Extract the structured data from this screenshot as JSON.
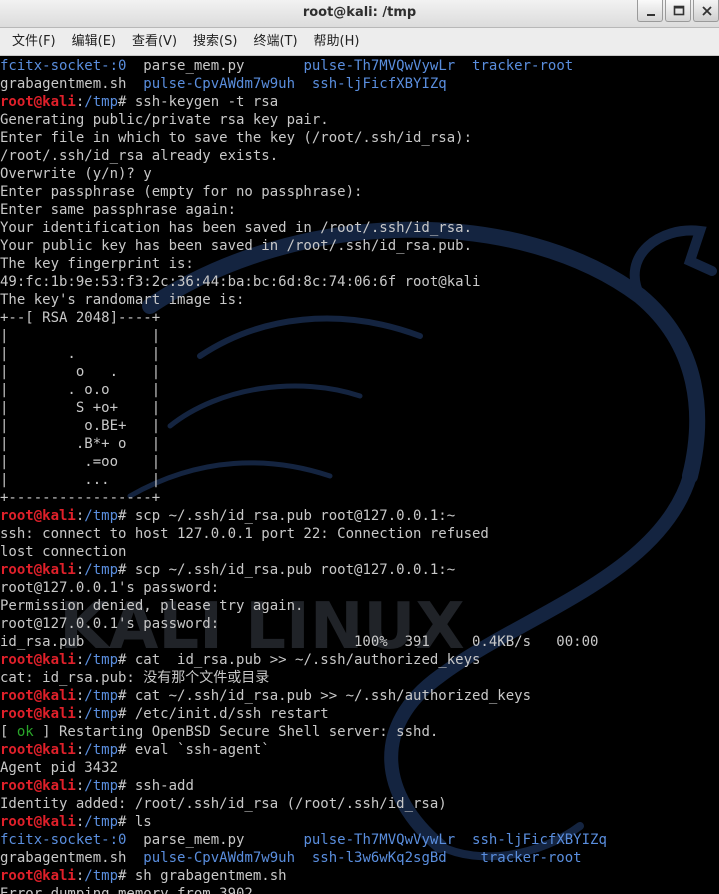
{
  "window": {
    "title": "root@kali: /tmp",
    "buttons": [
      "minimize",
      "maximize",
      "close"
    ]
  },
  "menu": [
    "文件(F)",
    "编辑(E)",
    "查看(V)",
    "搜索(S)",
    "终端(T)",
    "帮助(H)"
  ],
  "watermark": "KALI LINUX",
  "colors": {
    "background": "#000000",
    "text": "#c8c8c8",
    "prompt_user": "#e0202a",
    "prompt_path": "#5a8ede",
    "ok": "#2aa62a",
    "dir": "#5a8ede"
  },
  "lines": [
    {
      "segs": [
        [
          "p",
          "fcitx-socket-:0"
        ],
        [
          "t",
          "  parse_mem.py       "
        ],
        [
          "p",
          "pulse-Th7MVQwVywLr  tracker-root"
        ]
      ]
    },
    {
      "segs": [
        [
          "t",
          "grabagentmem.sh  "
        ],
        [
          "p",
          "pulse-CpvAWdm7w9uh  ssh-ljFicfXBYIZq"
        ]
      ]
    },
    {
      "segs": [
        [
          "u",
          "root@kali"
        ],
        [
          "t",
          ":"
        ],
        [
          "p",
          "/tmp"
        ],
        [
          "t",
          "# ssh-keygen -t rsa"
        ]
      ]
    },
    {
      "segs": [
        [
          "t",
          "Generating public/private rsa key pair."
        ]
      ]
    },
    {
      "segs": [
        [
          "t",
          "Enter file in which to save the key (/root/.ssh/id_rsa):"
        ]
      ]
    },
    {
      "segs": [
        [
          "t",
          "/root/.ssh/id_rsa already exists."
        ]
      ]
    },
    {
      "segs": [
        [
          "t",
          "Overwrite (y/n)? y"
        ]
      ]
    },
    {
      "segs": [
        [
          "t",
          "Enter passphrase (empty for no passphrase):"
        ]
      ]
    },
    {
      "segs": [
        [
          "t",
          "Enter same passphrase again:"
        ]
      ]
    },
    {
      "segs": [
        [
          "t",
          "Your identification has been saved in /root/.ssh/id_rsa."
        ]
      ]
    },
    {
      "segs": [
        [
          "t",
          "Your public key has been saved in /root/.ssh/id_rsa.pub."
        ]
      ]
    },
    {
      "segs": [
        [
          "t",
          "The key fingerprint is:"
        ]
      ]
    },
    {
      "segs": [
        [
          "t",
          "49:fc:1b:9e:53:f3:2c:36:44:ba:bc:6d:8c:74:06:6f root@kali"
        ]
      ]
    },
    {
      "segs": [
        [
          "t",
          "The key's randomart image is:"
        ]
      ]
    },
    {
      "segs": [
        [
          "t",
          "+--[ RSA 2048]----+"
        ]
      ]
    },
    {
      "segs": [
        [
          "t",
          "|                 |"
        ]
      ]
    },
    {
      "segs": [
        [
          "t",
          "|       .         |"
        ]
      ]
    },
    {
      "segs": [
        [
          "t",
          "|        o   .    |"
        ]
      ]
    },
    {
      "segs": [
        [
          "t",
          "|       . o.o     |"
        ]
      ]
    },
    {
      "segs": [
        [
          "t",
          "|        S +o+    |"
        ]
      ]
    },
    {
      "segs": [
        [
          "t",
          "|         o.BE+   |"
        ]
      ]
    },
    {
      "segs": [
        [
          "t",
          "|        .B*+ o   |"
        ]
      ]
    },
    {
      "segs": [
        [
          "t",
          "|         .=oo    |"
        ]
      ]
    },
    {
      "segs": [
        [
          "t",
          "|         ...     |"
        ]
      ]
    },
    {
      "segs": [
        [
          "t",
          "+-----------------+"
        ]
      ]
    },
    {
      "segs": [
        [
          "u",
          "root@kali"
        ],
        [
          "t",
          ":"
        ],
        [
          "p",
          "/tmp"
        ],
        [
          "t",
          "# scp ~/.ssh/id_rsa.pub root@127.0.0.1:~"
        ]
      ]
    },
    {
      "segs": [
        [
          "t",
          "ssh: connect to host 127.0.0.1 port 22: Connection refused"
        ]
      ]
    },
    {
      "segs": [
        [
          "t",
          "lost connection"
        ]
      ]
    },
    {
      "segs": [
        [
          "u",
          "root@kali"
        ],
        [
          "t",
          ":"
        ],
        [
          "p",
          "/tmp"
        ],
        [
          "t",
          "# scp ~/.ssh/id_rsa.pub root@127.0.0.1:~"
        ]
      ]
    },
    {
      "segs": [
        [
          "t",
          "root@127.0.0.1's password:"
        ]
      ]
    },
    {
      "segs": [
        [
          "t",
          "Permission denied, please try again."
        ]
      ]
    },
    {
      "segs": [
        [
          "t",
          "root@127.0.0.1's password:"
        ]
      ]
    },
    {
      "segs": [
        [
          "t",
          "id_rsa.pub                                100%  391     0.4KB/s   00:00"
        ]
      ]
    },
    {
      "segs": [
        [
          "u",
          "root@kali"
        ],
        [
          "t",
          ":"
        ],
        [
          "p",
          "/tmp"
        ],
        [
          "t",
          "# cat  id_rsa.pub >> ~/.ssh/authorized_keys"
        ]
      ]
    },
    {
      "segs": [
        [
          "t",
          "cat: id_rsa.pub: 没有那个文件或目录"
        ]
      ]
    },
    {
      "segs": [
        [
          "u",
          "root@kali"
        ],
        [
          "t",
          ":"
        ],
        [
          "p",
          "/tmp"
        ],
        [
          "t",
          "# cat ~/.ssh/id_rsa.pub >> ~/.ssh/authorized_keys"
        ]
      ]
    },
    {
      "segs": [
        [
          "u",
          "root@kali"
        ],
        [
          "t",
          ":"
        ],
        [
          "p",
          "/tmp"
        ],
        [
          "t",
          "# /etc/init.d/ssh restart"
        ]
      ]
    },
    {
      "segs": [
        [
          "t",
          "[ "
        ],
        [
          "g",
          "ok"
        ],
        [
          "t",
          " ] Restarting OpenBSD Secure Shell server: sshd."
        ]
      ]
    },
    {
      "segs": [
        [
          "u",
          "root@kali"
        ],
        [
          "t",
          ":"
        ],
        [
          "p",
          "/tmp"
        ],
        [
          "t",
          "# eval `ssh-agent`"
        ]
      ]
    },
    {
      "segs": [
        [
          "t",
          "Agent pid 3432"
        ]
      ]
    },
    {
      "segs": [
        [
          "u",
          "root@kali"
        ],
        [
          "t",
          ":"
        ],
        [
          "p",
          "/tmp"
        ],
        [
          "t",
          "# ssh-add"
        ]
      ]
    },
    {
      "segs": [
        [
          "t",
          "Identity added: /root/.ssh/id_rsa (/root/.ssh/id_rsa)"
        ]
      ]
    },
    {
      "segs": [
        [
          "u",
          "root@kali"
        ],
        [
          "t",
          ":"
        ],
        [
          "p",
          "/tmp"
        ],
        [
          "t",
          "# ls"
        ]
      ]
    },
    {
      "segs": [
        [
          "p",
          "fcitx-socket-:0"
        ],
        [
          "t",
          "  parse_mem.py       "
        ],
        [
          "p",
          "pulse-Th7MVQwVywLr  ssh-ljFicfXBYIZq"
        ]
      ]
    },
    {
      "segs": [
        [
          "t",
          "grabagentmem.sh  "
        ],
        [
          "p",
          "pulse-CpvAWdm7w9uh  ssh-l3w6wKq2sgBd    tracker-root"
        ]
      ]
    },
    {
      "segs": [
        [
          "u",
          "root@kali"
        ],
        [
          "t",
          ":"
        ],
        [
          "p",
          "/tmp"
        ],
        [
          "t",
          "# sh grabagentmem.sh"
        ]
      ]
    },
    {
      "segs": [
        [
          "t",
          "Error dumping memory from 3902"
        ]
      ]
    }
  ]
}
